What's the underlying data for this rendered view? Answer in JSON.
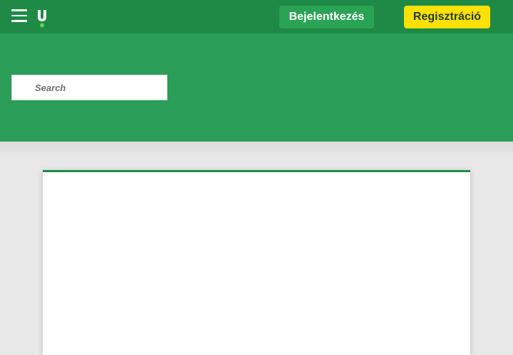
{
  "header": {
    "menu_icon": "hamburger-icon",
    "logo_icon": "unibet-logo-icon",
    "login_label": "Bejelentkezés",
    "register_label": "Regisztráció"
  },
  "search": {
    "placeholder": "Search",
    "value": ""
  },
  "colors": {
    "topbar": "#1f8a45",
    "hero": "#2a9e59",
    "login_button": "#2aa355",
    "register_button": "#ffe000",
    "background": "#e8e8e8"
  }
}
